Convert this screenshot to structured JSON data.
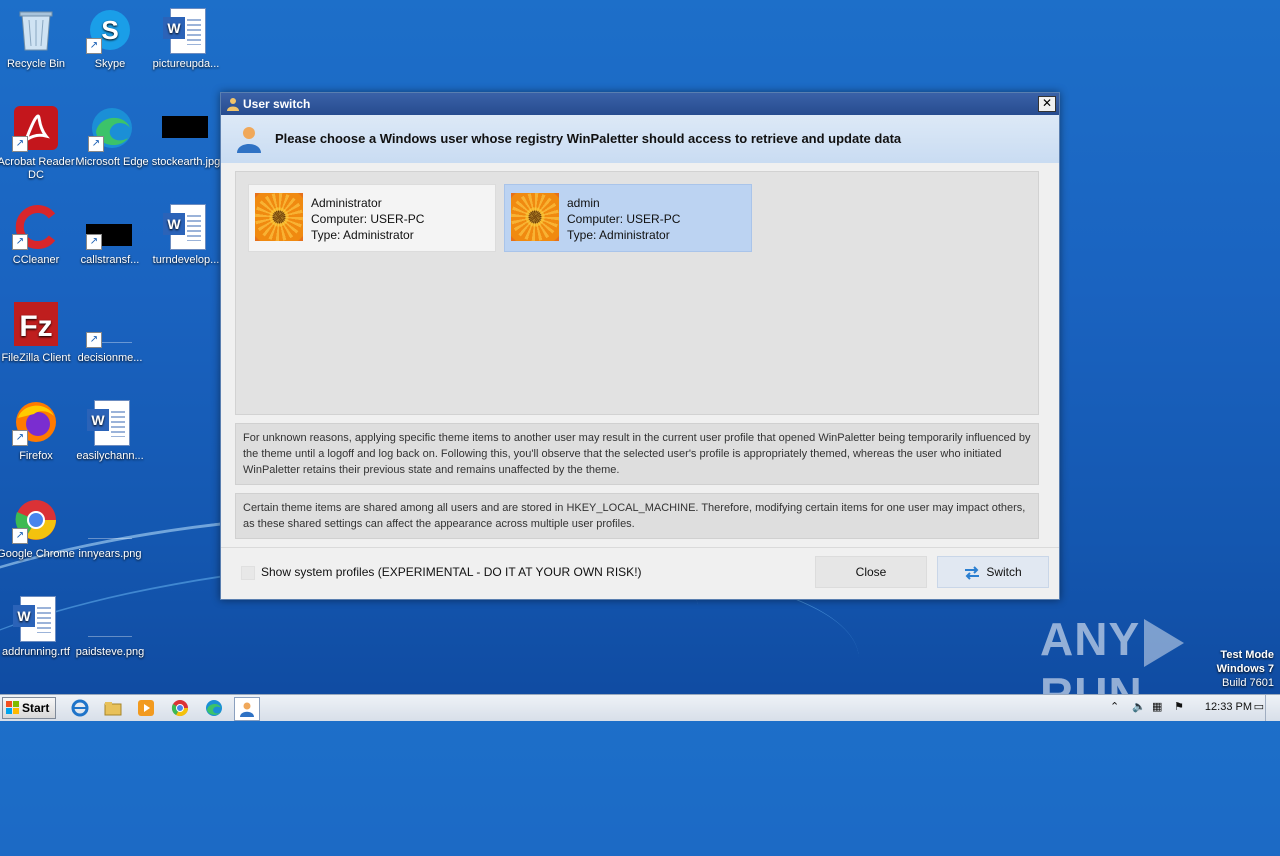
{
  "desktop": {
    "icons": [
      {
        "label": "Recycle Bin",
        "icon": "recycle-bin-icon"
      },
      {
        "label": "Skype",
        "icon": "skype-icon"
      },
      {
        "label": "pictureupda...",
        "icon": "word-doc-icon"
      },
      {
        "label": "Acrobat Reader DC",
        "icon": "acrobat-icon"
      },
      {
        "label": "Microsoft Edge",
        "icon": "edge-icon"
      },
      {
        "label": "stockearth.jpg",
        "icon": "image-thumb-icon"
      },
      {
        "label": "CCleaner",
        "icon": "ccleaner-icon"
      },
      {
        "label": "callstransf...",
        "icon": "image-thumb-icon"
      },
      {
        "label": "turndevelop...",
        "icon": "word-doc-icon"
      },
      {
        "label": "FileZilla Client",
        "icon": "filezilla-icon"
      },
      {
        "label": "decisionme...",
        "icon": "blank-file-icon"
      },
      {
        "label": "Firefox",
        "icon": "firefox-icon"
      },
      {
        "label": "easilychann...",
        "icon": "word-doc-icon"
      },
      {
        "label": "Google Chrome",
        "icon": "chrome-icon"
      },
      {
        "label": "innyears.png",
        "icon": "blank-file-icon"
      },
      {
        "label": "addrunning.rtf",
        "icon": "word-doc-icon"
      },
      {
        "label": "paidsteve.png",
        "icon": "blank-file-icon"
      }
    ]
  },
  "dialog": {
    "title": "User switch",
    "header": "Please choose a Windows user whose registry WinPaletter should access to retrieve and update data",
    "users": [
      {
        "name": "Administrator",
        "computer": "Computer: USER-PC",
        "type": "Type: Administrator",
        "selected": false
      },
      {
        "name": "admin",
        "computer": "Computer: USER-PC",
        "type": "Type: Administrator",
        "selected": true
      }
    ],
    "note1": "For unknown reasons, applying specific theme items to another user may result in the current user profile that opened WinPaletter being temporarily influenced by the theme until a logoff and log back on. Following this, you'll observe that the selected user's profile is appropriately themed, whereas the user who initiated WinPaletter retains their previous state and remains unaffected by the theme.",
    "note2": "Certain theme items are shared among all users and are stored in HKEY_LOCAL_MACHINE. Therefore, modifying certain items for one user may impact others, as these shared settings can affect the appearance across multiple user profiles.",
    "show_system_label": "Show system profiles (EXPERIMENTAL - DO IT AT YOUR OWN RISK!)",
    "show_system_checked": false,
    "close_label": "Close",
    "switch_label": "Switch"
  },
  "watermark": {
    "left": "ANY",
    "right": "RUN"
  },
  "os_info": {
    "line1": "Test Mode",
    "line2": "Windows 7",
    "line3": "Build 7601"
  },
  "taskbar": {
    "start_label": "Start",
    "clock": "12:33 PM",
    "pinned": [
      "ie-icon",
      "explorer-icon",
      "media-player-icon",
      "chrome-icon",
      "edge-icon",
      "winpaletter-icon"
    ]
  },
  "colors": {
    "selected_card": "#bcd3f2",
    "title_bar": "#274c8f"
  }
}
